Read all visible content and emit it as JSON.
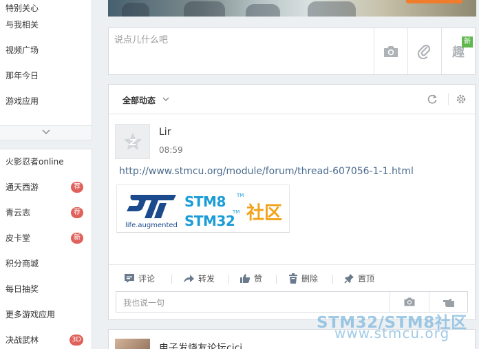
{
  "sidebar_top": {
    "items": [
      {
        "label": "特别关心"
      },
      {
        "label": "与我相关"
      },
      {
        "label": "视频广场"
      },
      {
        "label": "那年今日"
      },
      {
        "label": "游戏应用"
      }
    ]
  },
  "sidebar_games": {
    "items": [
      {
        "label": "火影忍者online",
        "badge": ""
      },
      {
        "label": "通天西游",
        "badge": "荐"
      },
      {
        "label": "青云志",
        "badge": "荐"
      },
      {
        "label": "皮卡堂",
        "badge": "新"
      },
      {
        "label": "积分商城",
        "badge": ""
      },
      {
        "label": "每日抽奖",
        "badge": ""
      },
      {
        "label": "更多游戏应用",
        "badge": ""
      },
      {
        "label": "决战武林",
        "badge": "3D"
      }
    ]
  },
  "publisher": {
    "placeholder": "说点儿什么吧",
    "fun_label": "趣",
    "new_badge": "新"
  },
  "feed": {
    "tab_label": "全部动态",
    "post": {
      "user": "Lir",
      "time": "08:59",
      "link": "http://www.stmcu.org/module/forum/thread-607056-1-1.html",
      "logo": {
        "line1": "STM8",
        "line2": "STM32",
        "tm": "TM",
        "community": "社区",
        "tagline": "life.augmented"
      }
    },
    "actions": {
      "comment": "评论",
      "forward": "转发",
      "like": "赞",
      "delete": "删除",
      "pin": "置顶"
    },
    "comment_placeholder": "我也说一句"
  },
  "next_post": {
    "title": "电子发烧友论坛cici"
  },
  "watermark": {
    "line1": "STM32/STM8社区",
    "line2": "www.stmcu.org"
  }
}
